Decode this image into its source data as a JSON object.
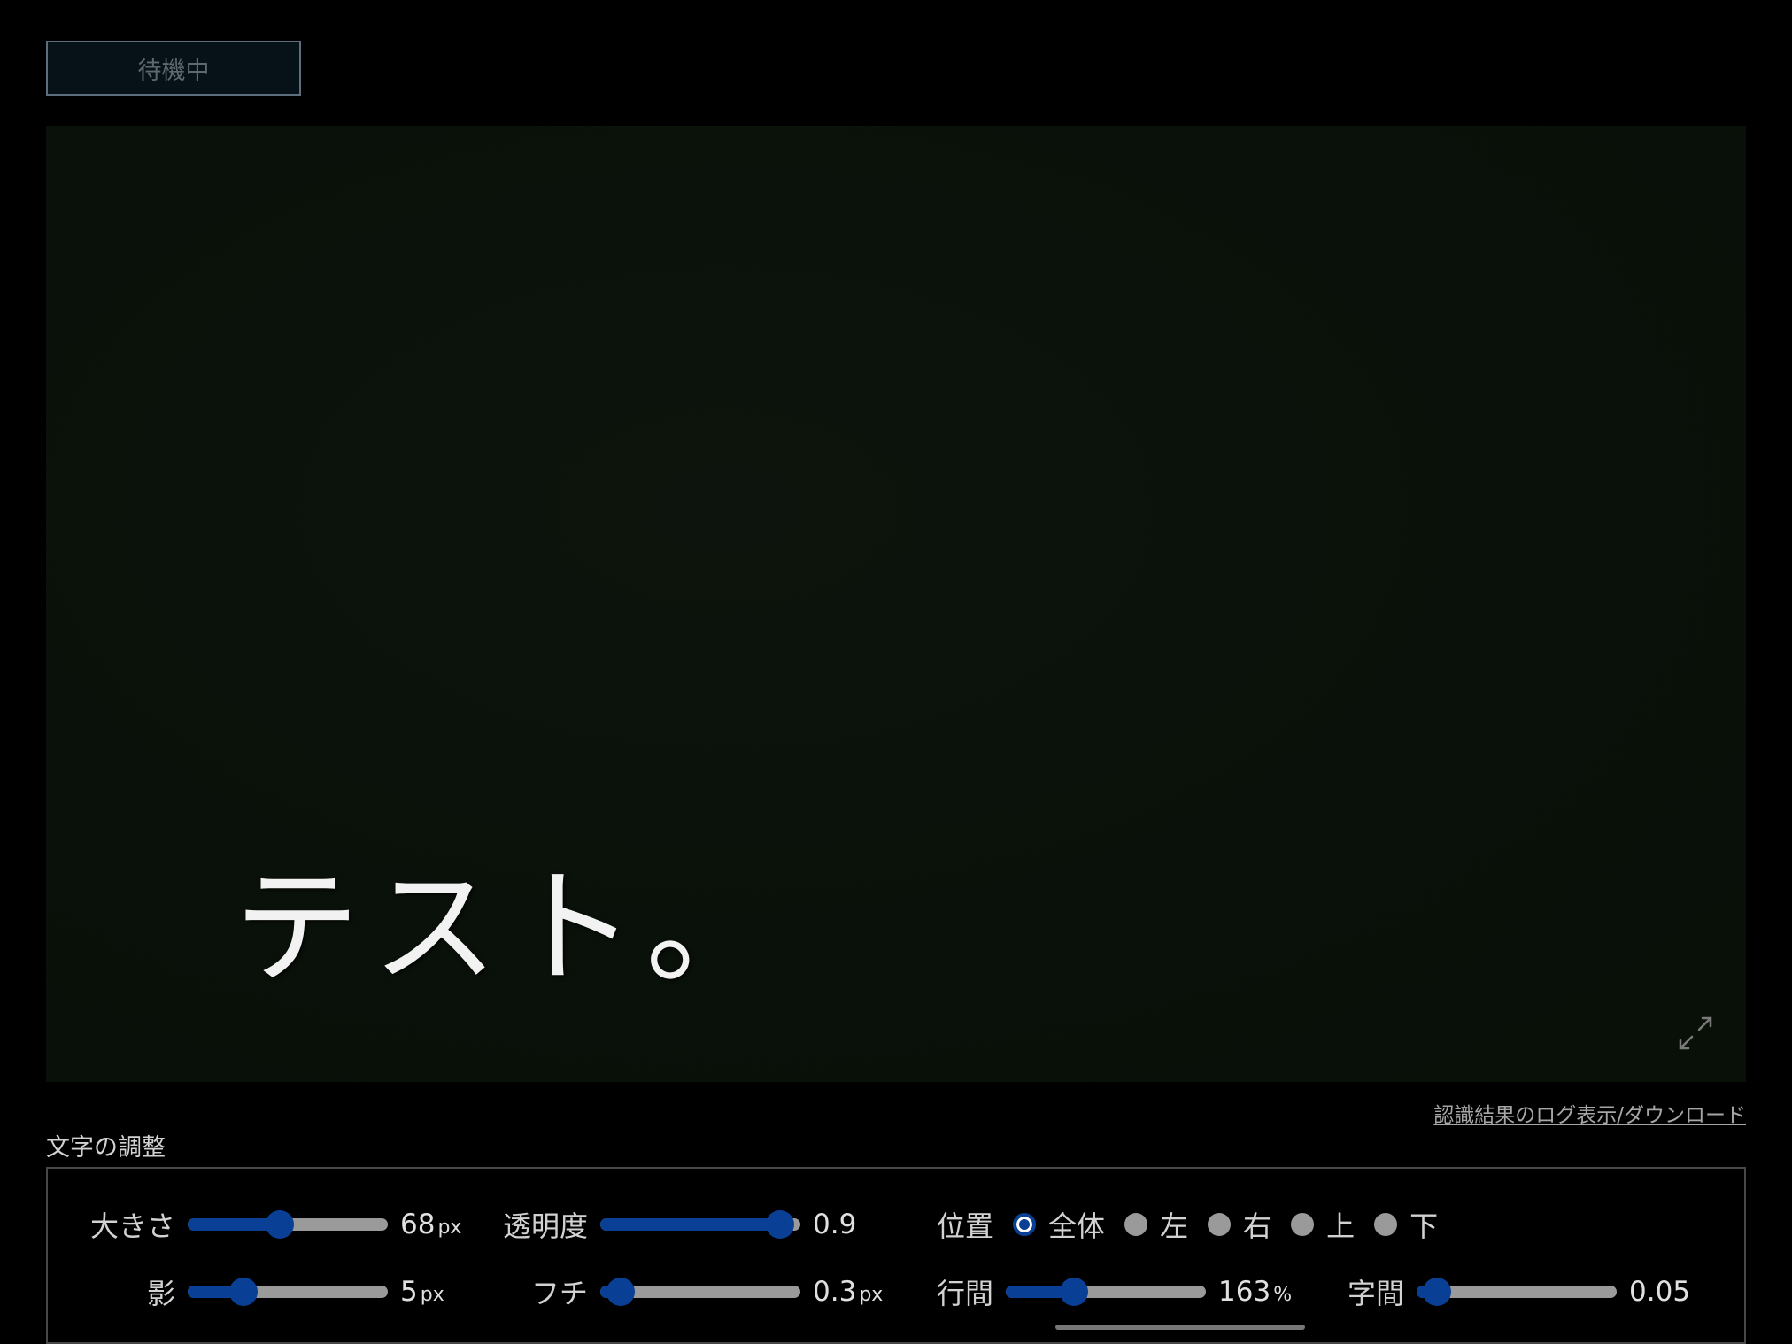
{
  "status": {
    "label": "待機中"
  },
  "preview": {
    "caption": "テスト。",
    "expand_icon": "expand-icon"
  },
  "log_link": "認識結果のログ表示/ダウンロード",
  "adjust": {
    "title": "文字の調整",
    "size": {
      "label": "大きさ",
      "value": "68",
      "unit": "px",
      "level": 0.46
    },
    "opacity": {
      "label": "透明度",
      "value": "0.9",
      "level": 0.9
    },
    "position": {
      "label": "位置",
      "options": [
        "全体",
        "左",
        "右",
        "上",
        "下"
      ],
      "selected": "全体"
    },
    "shadow": {
      "label": "影",
      "value": "5",
      "unit": "px",
      "level": 0.28
    },
    "outline": {
      "label": "フチ",
      "value": "0.3",
      "unit": "px",
      "level": 0.1
    },
    "line_height": {
      "label": "行間",
      "value": "163",
      "unit": "%",
      "level": 0.34
    },
    "letter_spacing": {
      "label": "字間",
      "value": "0.05",
      "level": 0.1
    }
  },
  "colors": {
    "accent": "#0a3f96",
    "background": "#000000",
    "preview_bg": "#0a110a"
  }
}
